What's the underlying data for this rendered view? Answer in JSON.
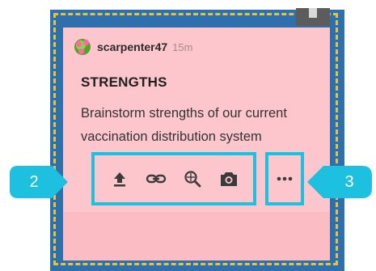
{
  "card": {
    "author": "scarpenter47",
    "time": "15m",
    "title": "STRENGTHS",
    "body": "Brainstorm strengths of our current vaccination distribution system"
  },
  "toolbar": {
    "icons": [
      "upload-icon",
      "link-icon",
      "search-icon",
      "camera-icon",
      "more-icon"
    ]
  },
  "callouts": [
    "2",
    "3"
  ],
  "colors": {
    "card_bg": "#fdc6cc",
    "frame": "#2e6fae",
    "dashed": "#e8c23c",
    "highlight": "#1ec0e0",
    "callout": "#1ec0e0"
  }
}
